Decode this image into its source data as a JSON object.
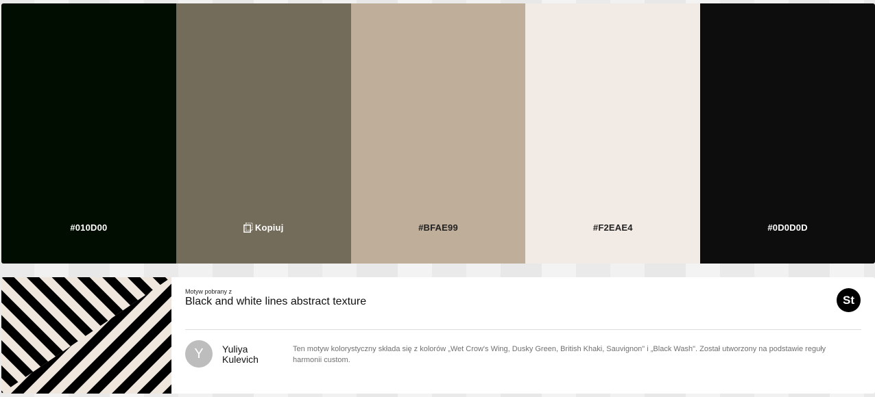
{
  "swatches": [
    {
      "label": "#010D00",
      "color": "#010D00",
      "text_color": "#ffffff"
    },
    {
      "label": "Kopiuj",
      "color": "#746C5A",
      "text_color": "#ffffff",
      "icon": "copy-icon"
    },
    {
      "label": "#BFAE99",
      "color": "#BFAE99",
      "text_color": "#222222"
    },
    {
      "label": "#F2EAE4",
      "color": "#F2EAE4",
      "text_color": "#222222"
    },
    {
      "label": "#0D0D0D",
      "color": "#0D0D0D",
      "text_color": "#ffffff"
    }
  ],
  "info": {
    "source_label": "Motyw pobrany z",
    "title": "Black and white lines abstract texture",
    "stock_badge": "St",
    "author_initial": "Y",
    "author_name": "Yuliya Kulevich",
    "description": "Ten motyw kolorystyczny składa się z kolorów „Wet Crow's Wing, Dusky Green, British Khaki, Sauvignon\" i „Black Wash\". Został utworzony na podstawie reguły harmonii custom."
  }
}
